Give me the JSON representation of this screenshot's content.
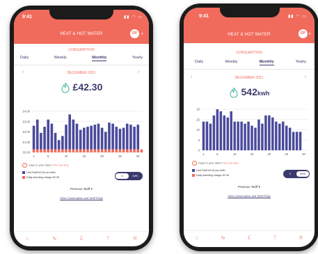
{
  "phones": [
    {
      "time": "9:41",
      "title": "HEAT & HOT WATER",
      "avatar": "DP",
      "section": "CONSUMPTION",
      "tabs": [
        "Daily",
        "Weekly",
        "Monthly",
        "Yearly"
      ],
      "active_tab": "Monthly",
      "month": "DECEMBER 2021",
      "value": "£42.30",
      "unit": "",
      "gaps_text": "Gaps in your data?",
      "gaps_link": "Find out why",
      "legend_unit": "Unit Tariff £0.05 per kWh",
      "legend_standing": "Daily standing charge £0.30",
      "toggle": [
        "£",
        "kWh"
      ],
      "toggle_on": "£",
      "previous_tariff": "Previous Tariff",
      "faq_link": "View Consumption and Tariff FAQs",
      "nav_icons": [
        "home-icon",
        "graph-icon",
        "pound-icon",
        "help-icon",
        "settings-icon"
      ]
    },
    {
      "time": "9:41",
      "title": "HEAT & HOT WATER",
      "avatar": "DP",
      "section": "CONSUMPTION",
      "tabs": [
        "Daily",
        "Weekly",
        "Monthly",
        "Yearly"
      ],
      "active_tab": "Monthly",
      "month": "DECEMBER 2021",
      "value": "542",
      "unit": "kwh",
      "gaps_text": "Gaps in your data?",
      "gaps_link": "Find out why",
      "legend_unit": "Unit Tariff £0.05 per kWh",
      "legend_standing": "Daily standing charge £0.30",
      "toggle": [
        "£",
        "kWh"
      ],
      "toggle_on": "kWh",
      "previous_tariff": "Previous Tariff",
      "faq_link": "View Consumption and Tariff FAQs",
      "nav_icons": [
        "home-icon",
        "graph-icon",
        "pound-icon",
        "help-icon",
        "settings-icon"
      ]
    }
  ],
  "colors": {
    "accent": "#f16b5c",
    "bar": "#4a4a9c",
    "standing": "#f16b5c",
    "text_dark": "#3a3a6e"
  },
  "chart_data": [
    {
      "type": "bar",
      "title": "",
      "xlabel": "",
      "ylabel": "",
      "ylim": [
        0,
        4
      ],
      "yticks": [
        "£0.00",
        "£1.00",
        "£2.00",
        "£3.00",
        "£4.00"
      ],
      "xticks": [
        "1",
        "5",
        "10",
        "15",
        "20",
        "25",
        "30"
      ],
      "categories": [
        "1",
        "2",
        "3",
        "4",
        "5",
        "6",
        "7",
        "8",
        "9",
        "10",
        "11",
        "12",
        "13",
        "14",
        "15",
        "16",
        "17",
        "18",
        "19",
        "20",
        "21",
        "22",
        "23",
        "24",
        "25",
        "26",
        "27",
        "28",
        "29",
        "30",
        "31"
      ],
      "series": [
        {
          "name": "Unit Tariff £0.05 per kWh",
          "values": [
            2.3,
            2.9,
            1.6,
            2.2,
            2.9,
            2.5,
            1.6,
            0.9,
            1.3,
            2.4,
            3.4,
            2.9,
            2.5,
            1.9,
            2.1,
            2.2,
            2.3,
            2.4,
            2.5,
            2.1,
            1.7,
            2.6,
            2.5,
            2.2,
            2.0,
            2.1,
            2.5,
            2.4,
            2.2,
            2.4,
            0
          ]
        },
        {
          "name": "Daily standing charge £0.30",
          "values": [
            0.3,
            0.3,
            0.3,
            0.3,
            0.3,
            0.3,
            0.3,
            0.3,
            0.3,
            0.3,
            0.3,
            0.3,
            0.3,
            0.3,
            0.3,
            0.3,
            0.3,
            0.3,
            0.3,
            0.3,
            0.3,
            0.3,
            0.3,
            0.3,
            0.3,
            0.3,
            0.3,
            0.3,
            0.3,
            0.3,
            0.3
          ]
        }
      ]
    },
    {
      "type": "bar",
      "title": "",
      "xlabel": "",
      "ylabel": "",
      "ylim": [
        0,
        20
      ],
      "yticks": [
        "0",
        "5",
        "10",
        "15",
        "20"
      ],
      "xticks": [
        "1",
        "5",
        "10",
        "15",
        "20",
        "25",
        "30"
      ],
      "categories": [
        "1",
        "2",
        "3",
        "4",
        "5",
        "6",
        "7",
        "8",
        "9",
        "10",
        "11",
        "12",
        "13",
        "14",
        "15",
        "16",
        "17",
        "18",
        "19",
        "20",
        "21",
        "22",
        "23",
        "24",
        "25",
        "26",
        "27",
        "28",
        "29",
        "30",
        "31"
      ],
      "series": [
        {
          "name": "Unit Tariff £0.05 per kWh",
          "values": [
            14,
            14,
            13,
            17,
            20,
            19,
            17,
            16,
            19,
            14,
            14,
            14,
            13,
            14,
            12,
            11,
            15,
            13,
            17,
            17,
            16,
            14,
            13,
            14,
            12,
            11,
            9,
            9,
            9,
            0,
            0
          ]
        }
      ]
    }
  ]
}
